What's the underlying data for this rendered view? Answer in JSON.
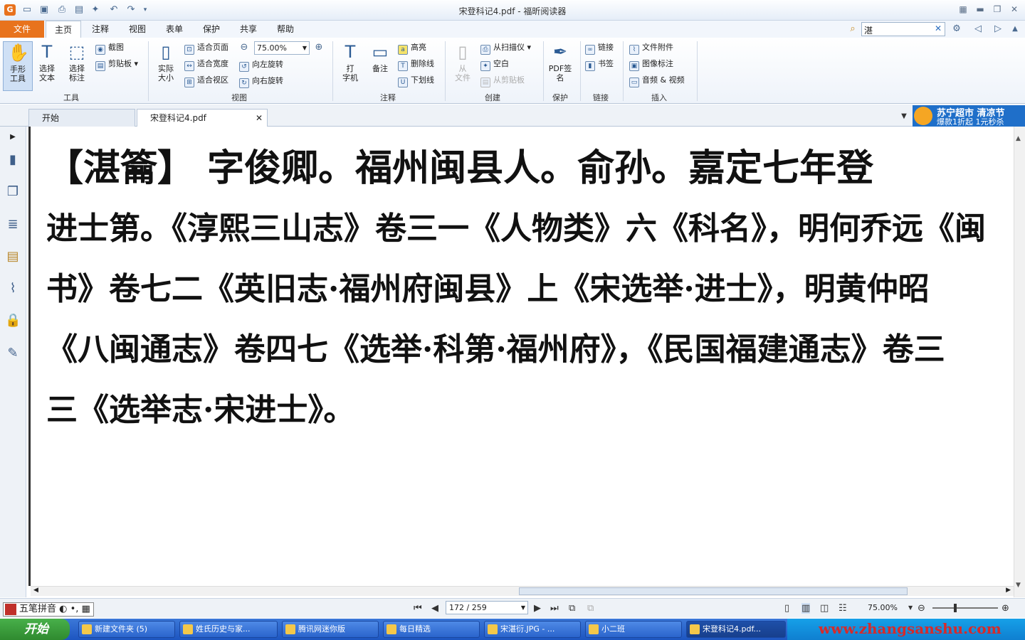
{
  "window": {
    "title": "宋登科记4.pdf - 福昕阅读器"
  },
  "menu": {
    "file": "文件",
    "tabs": [
      "主页",
      "注释",
      "视图",
      "表单",
      "保护",
      "共享",
      "帮助"
    ]
  },
  "search": {
    "value": "湛"
  },
  "ribbon": {
    "tools": {
      "hand": "手形\n工具",
      "select_text": "选择\n文本",
      "select_annot": "选择\n标注",
      "snapshot": "截图",
      "clipboard": "剪贴板",
      "label": "工具"
    },
    "view": {
      "actual_size": "实际\n大小",
      "fit_page": "适合页面",
      "fit_width": "适合宽度",
      "fit_visible": "适合视区",
      "zoom": "75.00%",
      "rotate_left": "向左旋转",
      "rotate_right": "向右旋转",
      "label": "视图"
    },
    "annot": {
      "typewriter": "打\n字机",
      "note": "备注",
      "highlight": "高亮",
      "strikeout": "删除线",
      "underline": "下划线",
      "label": "注释"
    },
    "create": {
      "from_file": "从\n文件",
      "from_scanner": "从扫描仪",
      "blank": "空白",
      "from_clipboard": "从剪贴板",
      "label": "创建"
    },
    "protect": {
      "pdf_sign": "PDF签\n名",
      "label": "保护"
    },
    "links": {
      "link": "链接",
      "bookmark": "书签",
      "label": "链接"
    },
    "insert": {
      "attachment": "文件附件",
      "image_annot": "图像标注",
      "audio_video": "音频 & 视频",
      "label": "插入"
    }
  },
  "doc_tabs": [
    "开始",
    "宋登科记4.pdf"
  ],
  "ad": {
    "line1": "苏宁超市 清凉节",
    "line2": "爆款1折起 1元秒杀"
  },
  "document": {
    "lines": [
      "【湛籥】 字俊卿。福州闽县人。俞孙。嘉定七年登",
      "进士第。《淳熙三山志》卷三一《人物类》六《科名》，明何乔远《闽",
      "书》卷七二《英旧志·福州府闽县》上《宋选举·进士》，明黄仲昭",
      "《八闽通志》卷四七《选举·科第·福州府》，《民国福建通志》卷三",
      "三《选举志·宋进士》。"
    ]
  },
  "status": {
    "ime": "五笔拼音",
    "page": "172 / 259",
    "zoom": "75.00%"
  },
  "taskbar": {
    "start": "开始",
    "items": [
      "新建文件夹 (5)",
      "姓氏历史与家...",
      "腾讯网迷你版",
      "每日精选",
      "宋湛衍.JPG - ...",
      "小二班",
      "宋登科记4.pdf..."
    ],
    "watermark": "www.zhangsanshu.com"
  }
}
